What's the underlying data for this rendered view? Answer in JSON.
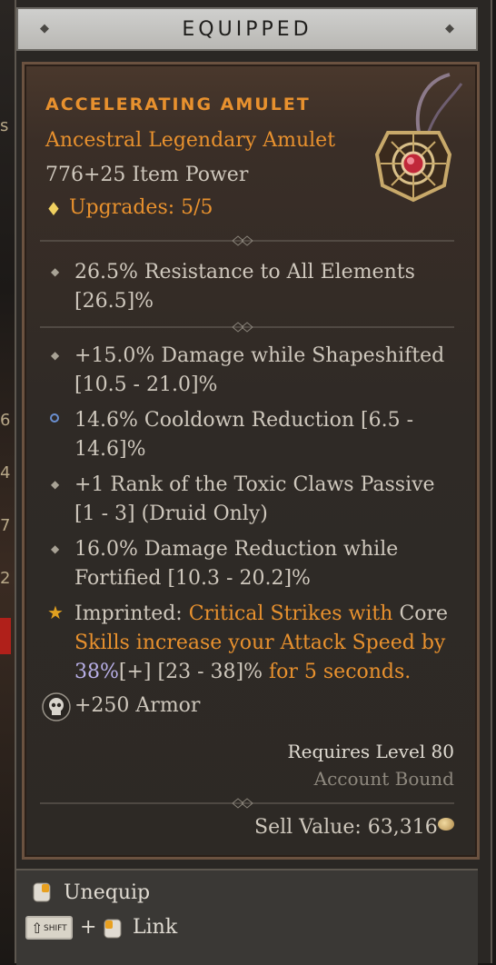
{
  "header": {
    "title": "EQUIPPED"
  },
  "item": {
    "name": "ACCELERATING AMULET",
    "type": "Ancestral Legendary Amulet",
    "item_power": "776+25 Item Power",
    "upgrades": "Upgrades: 5/5",
    "implicit": {
      "line1": "26.5% Resistance to All Elements",
      "line2": "[26.5]%"
    },
    "affixes": [
      {
        "line1": "+15.0% Damage while Shapeshifted",
        "line2": "[10.5 - 21.0]%"
      },
      {
        "line1": "14.6% Cooldown Reduction [6.5 -",
        "line2": "14.6]%"
      },
      {
        "line1": "+1 Rank of the Toxic Claws Passive",
        "line2": "[1 - 3] (Druid Only)"
      },
      {
        "line1": "16.0% Damage Reduction while",
        "line2": "Fortified [10.3 - 20.2]%"
      }
    ],
    "aspect": {
      "prefix": "Imprinted:",
      "a1": "Critical Strikes with",
      "a2": "Core",
      "a3": "Skills increase your Attack Speed by",
      "value": "38%",
      "plus": "[+]",
      "range": "[23 - 38]%",
      "tail": "for 5 seconds."
    },
    "armor": "+250 Armor",
    "requires_level": "Requires Level 80",
    "bound": "Account Bound",
    "sell_value": "Sell Value: 63,316"
  },
  "footer": {
    "unequip": "Unequip",
    "link": "Link",
    "shift_key": "SHIFT",
    "plus": "+"
  },
  "colors": {
    "legendary_orange": "#e8912e",
    "text": "#cfc8bd",
    "blue_value": "#b9b0e8"
  }
}
